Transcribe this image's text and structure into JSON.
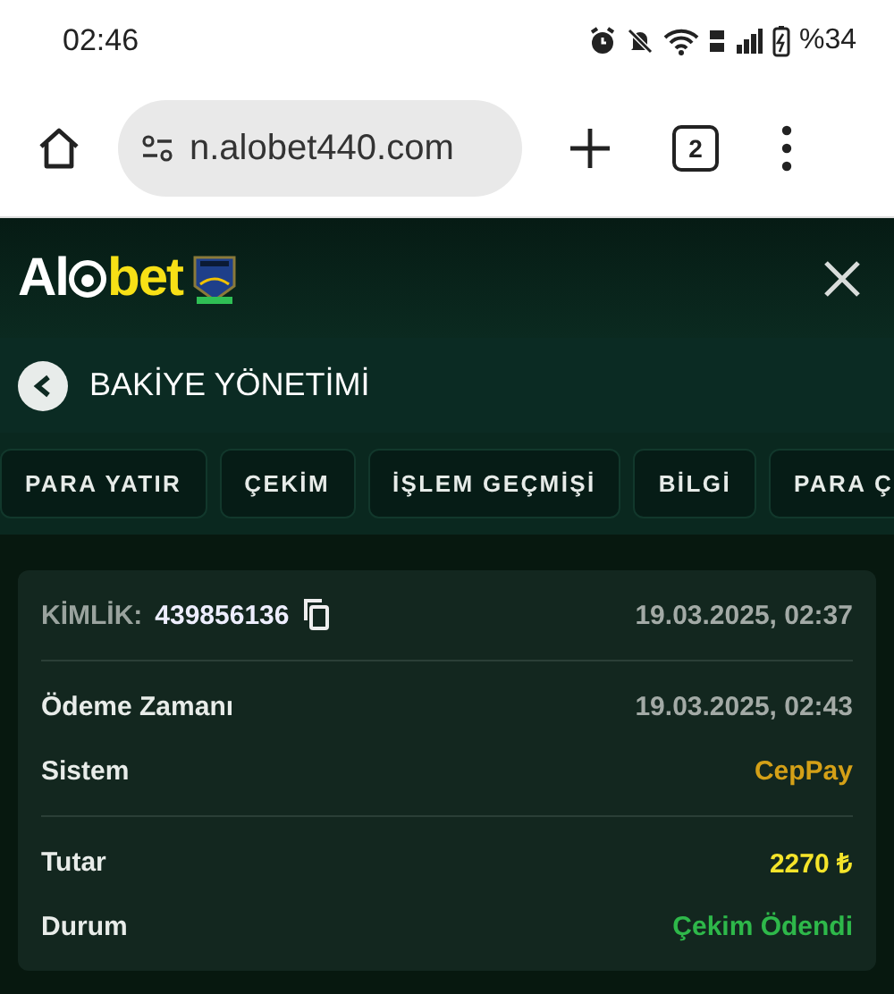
{
  "status_bar": {
    "time": "02:46",
    "battery": "%34"
  },
  "browser": {
    "url": "n.alobet440.com",
    "tab_count": "2"
  },
  "header": {
    "logo": {
      "lead": "Al",
      "tail": "bet"
    }
  },
  "page_title": "BAKİYE YÖNETİMİ",
  "tabs": [
    "PARA YATIR",
    "ÇEKİM",
    "İŞLEM GEÇMİŞİ",
    "BİLGİ",
    "PARA Ç"
  ],
  "transaction": {
    "id_label": "KİMLİK:",
    "id": "439856136",
    "created": "19.03.2025, 02:37",
    "sections": [
      [
        {
          "label": "Ödeme Zamanı",
          "value": "19.03.2025, 02:43",
          "color": "#a3aaa6"
        },
        {
          "label": "Sistem",
          "value": "CepPay",
          "color": "#d4a017"
        }
      ],
      [
        {
          "label": "Tutar",
          "value": "2270 ₺",
          "color": "#f5e42a"
        },
        {
          "label": "Durum",
          "value": "Çekim Ödendi",
          "color": "#2eb84a"
        }
      ]
    ]
  }
}
